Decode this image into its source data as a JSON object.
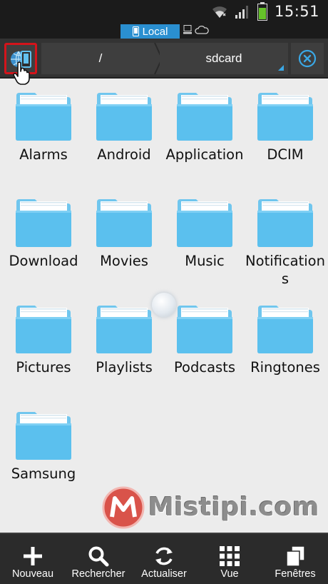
{
  "status_bar": {
    "time": "15:51",
    "battery_color": "#66c32a"
  },
  "sources": {
    "active_label": "Local",
    "active_color": "#2a8fd0",
    "other_icons": [
      "computer-icon",
      "cloud-icon"
    ]
  },
  "path": {
    "root": "/",
    "current": "sdcard"
  },
  "folders": [
    "Alarms",
    "Android",
    "Application",
    "DCIM",
    "Download",
    "Movies",
    "Music",
    "Notifications",
    "Pictures",
    "Playlists",
    "Podcasts",
    "Ringtones",
    "Samsung"
  ],
  "folder_color": "#5bc0ee",
  "watermark": {
    "text": "Mistipi.com"
  },
  "bottom_bar": [
    {
      "label": "Nouveau",
      "icon": "plus-icon"
    },
    {
      "label": "Rechercher",
      "icon": "search-icon"
    },
    {
      "label": "Actualiser",
      "icon": "refresh-icon"
    },
    {
      "label": "Vue",
      "icon": "grid-icon"
    },
    {
      "label": "Fenêtres",
      "icon": "windows-icon"
    }
  ]
}
